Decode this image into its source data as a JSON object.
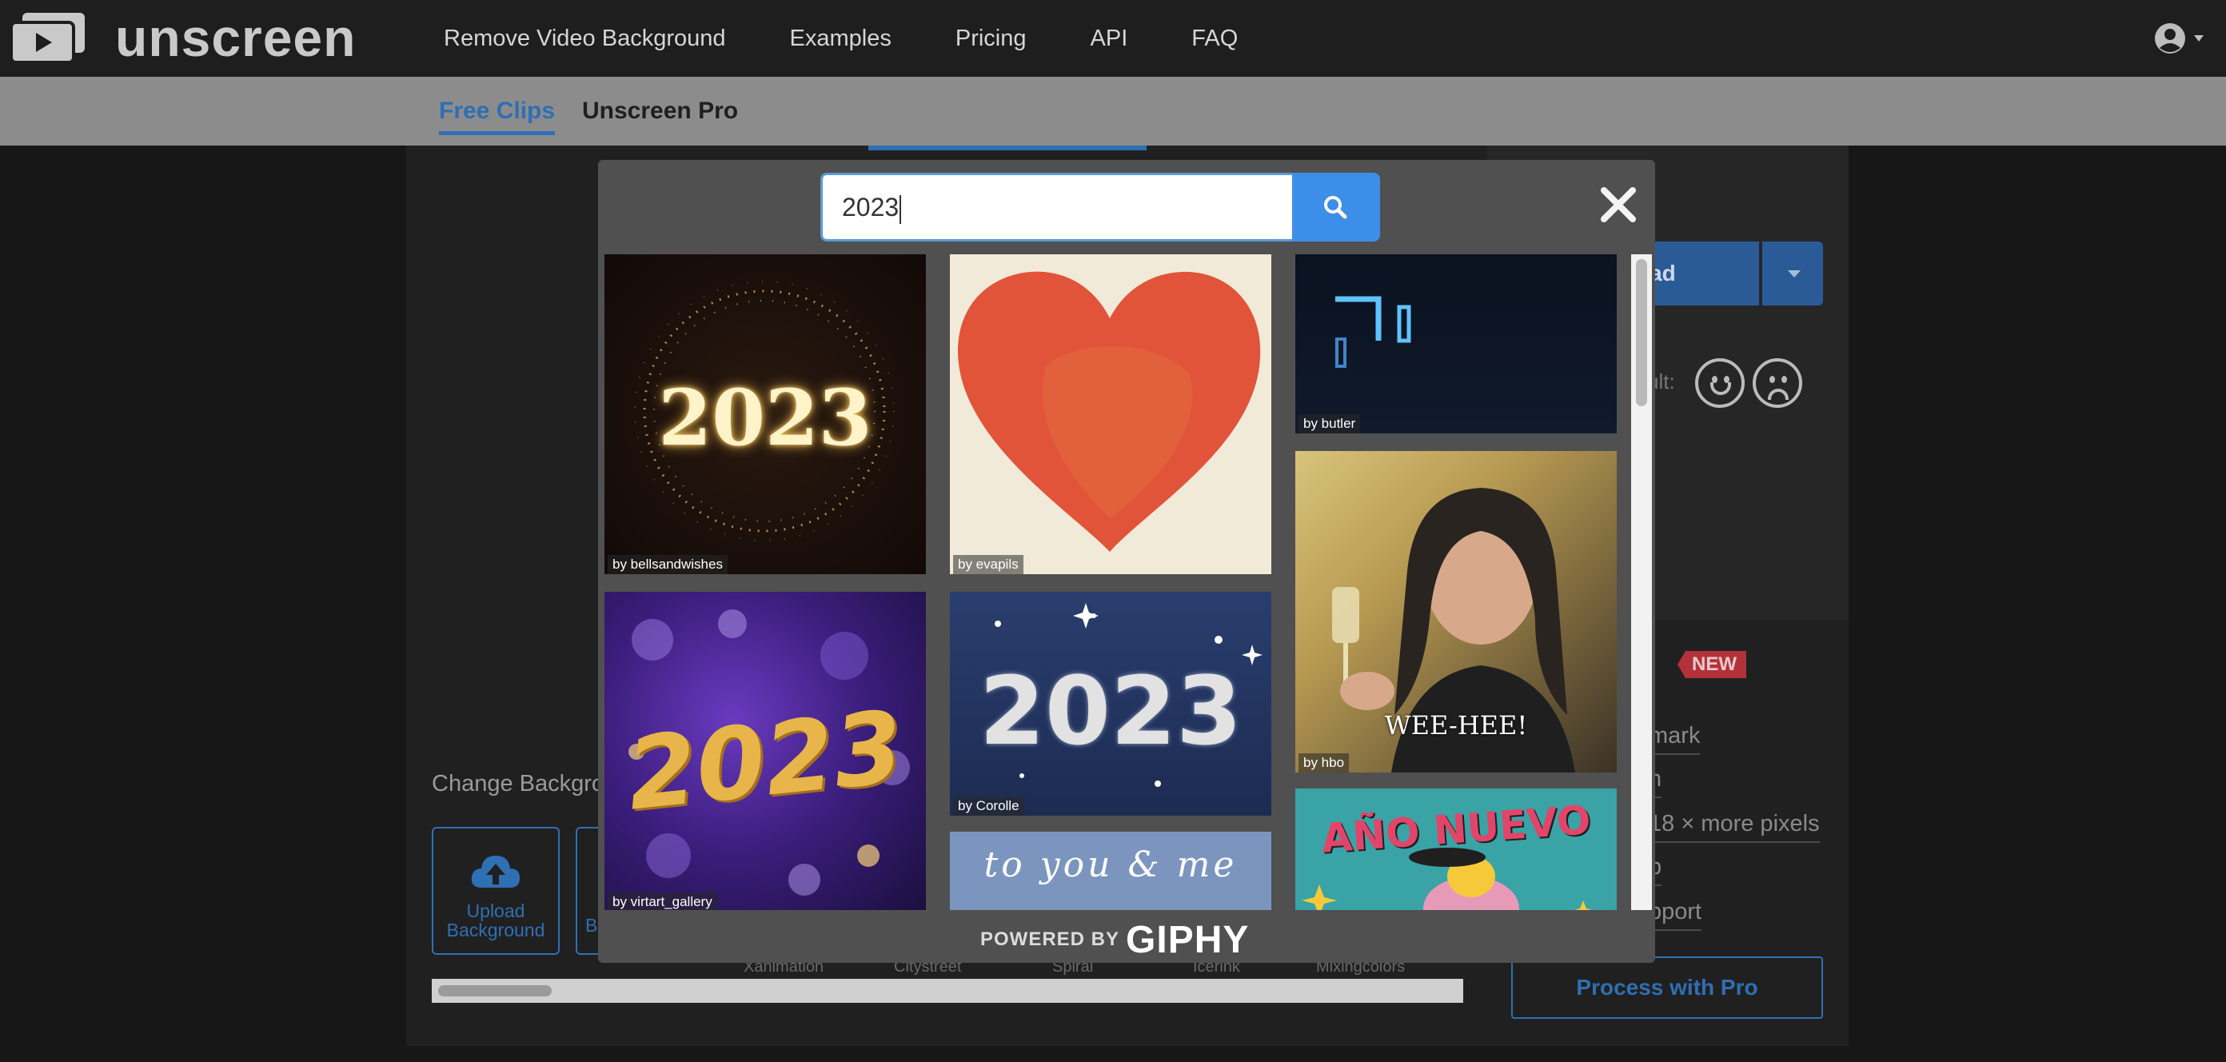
{
  "brand": {
    "name": "unscreen"
  },
  "nav": {
    "links": [
      "Remove Video Background",
      "Examples",
      "Pricing",
      "API",
      "FAQ"
    ]
  },
  "subnav": {
    "tabs": [
      "Free Clips",
      "Unscreen Pro"
    ]
  },
  "background_page": {
    "download_label": "oad",
    "rate_label": "ult:",
    "new_badge": "NEW",
    "pro_features": [
      "mark",
      "h",
      "18 × more pixels",
      "p",
      "pport"
    ],
    "process_pro_label": "Process with Pro",
    "change_background_label": "Change Backgro",
    "upload_background_label": "Upload Background",
    "next_tile_label": "B",
    "background_names": [
      "Xanimation",
      "Citystreet",
      "Spiral",
      "Icerink",
      "Mixingcolors"
    ]
  },
  "modal": {
    "search": {
      "value": "2023",
      "placeholder": ""
    },
    "results": [
      {
        "credit": "by bellsandwishes",
        "text": "2023"
      },
      {
        "credit": "by evapils",
        "text": ""
      },
      {
        "credit": "by butler",
        "text": ""
      },
      {
        "credit": "by hbo",
        "text": "WEE-HEE!"
      },
      {
        "credit": "by virtart_gallery",
        "text": "2023"
      },
      {
        "credit": "by Corolle",
        "text": "2023"
      },
      {
        "credit": "",
        "text": "to you & me"
      },
      {
        "credit": "",
        "text": "AÑO NUEVO"
      }
    ],
    "powered_by": "POWERED BY",
    "powered_brand": "GIPHY"
  },
  "colors": {
    "accent": "#2f6fb3",
    "search_button": "#3d8ee8",
    "new_badge": "#b3323a"
  }
}
